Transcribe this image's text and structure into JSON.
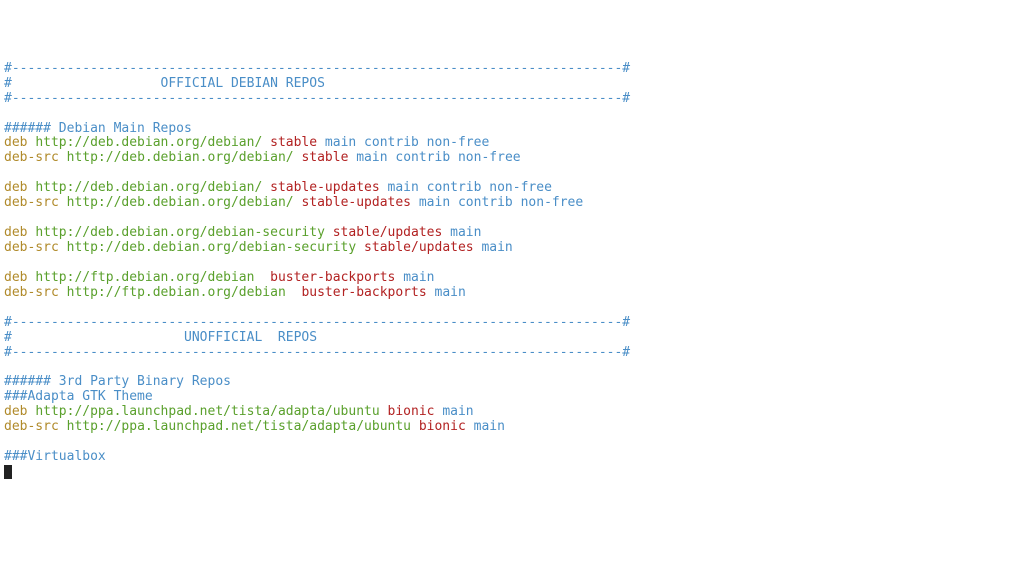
{
  "sep1": "#------------------------------------------------------------------------------#",
  "sep2": "#                   OFFICIAL DEBIAN REPOS                    ",
  "sep3": "#------------------------------------------------------------------------------#",
  "section1_title": "###### Debian Main Repos",
  "deb": "deb ",
  "debsrc": "deb-src ",
  "url_debian": "http://deb.debian.org/debian/ ",
  "url_debian_sec": "http://deb.debian.org/debian-security ",
  "url_ftp": "http://ftp.debian.org/debian ",
  "url_ppa": "http://ppa.launchpad.net/tista/adapta/ubuntu ",
  "stable": "stable ",
  "stable_updates": "stable-updates ",
  "stable_slash_updates": "stable/updates ",
  "buster_backports": "buster-backports ",
  "bionic": "bionic ",
  "comp_mcn": "main contrib non-free",
  "comp_m": "main",
  "sep4": "#------------------------------------------------------------------------------#",
  "sep5": "#                      UNOFFICIAL  REPOS",
  "sep6": "#------------------------------------------------------------------------------#",
  "section2_title": "###### 3rd Party Binary Repos",
  "adapta_title": "###Adapta GTK Theme",
  "vbox_title": "###Virtualbox"
}
